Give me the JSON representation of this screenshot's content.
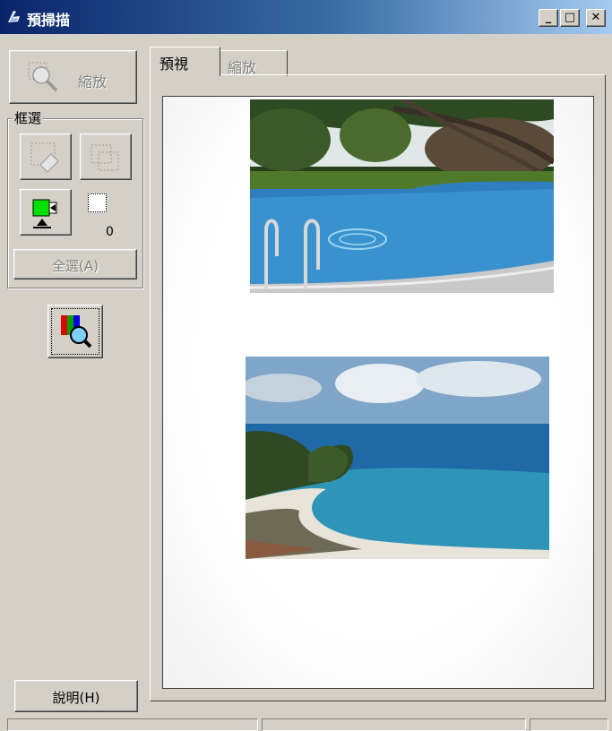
{
  "window": {
    "title": "預掃描",
    "minimize_glyph": "_",
    "maximize_glyph": "□",
    "close_glyph": "✕"
  },
  "left_panel": {
    "zoom_label": "縮放",
    "marquee_group_label": "框選",
    "marquee_count": "0",
    "select_all_label": "全選(A)",
    "help_label": "說明(H)"
  },
  "tabs": [
    {
      "label": "預視",
      "active": true
    },
    {
      "label": "縮放",
      "active": false
    }
  ],
  "preview": {
    "photos": [
      {
        "subject": "swimming pool"
      },
      {
        "subject": "coastal bay"
      }
    ]
  },
  "colors": {
    "titlebar_start": "#0a246a",
    "titlebar_end": "#a6caf0",
    "face": "#d4d0c8"
  }
}
